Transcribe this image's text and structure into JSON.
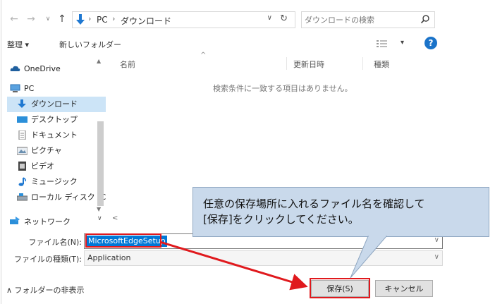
{
  "address_bar": {
    "back_icon": "arrow-left-icon",
    "forward_icon": "arrow-right-icon",
    "up_icon": "arrow-up-icon",
    "path": [
      "PC",
      "ダウンロード"
    ],
    "refresh_icon": "refresh-icon",
    "search_placeholder": "ダウンロードの検索"
  },
  "toolbar": {
    "organize_label": "整理 ▾",
    "new_folder_label": "新しいフォルダー",
    "view_icon": "view-options-icon",
    "help_label": "?"
  },
  "nav_pane": {
    "items": [
      {
        "label": "OneDrive",
        "icon": "cloud-icon"
      },
      {
        "label": "PC",
        "icon": "computer-icon"
      },
      {
        "label": "ダウンロード",
        "icon": "download-arrow-icon"
      },
      {
        "label": "デスクトップ",
        "icon": "desktop-icon"
      },
      {
        "label": "ドキュメント",
        "icon": "document-icon"
      },
      {
        "label": "ピクチャ",
        "icon": "pictures-icon"
      },
      {
        "label": "ビデオ",
        "icon": "video-icon"
      },
      {
        "label": "ミュージック",
        "icon": "music-icon"
      },
      {
        "label": "ローカル ディスク (C",
        "icon": "disk-icon"
      },
      {
        "label": "ネットワーク",
        "icon": "network-icon"
      }
    ],
    "selected_index": 2
  },
  "file_list": {
    "columns": [
      "名前",
      "更新日時",
      "種類"
    ],
    "empty_message": "検索条件に一致する項目はありません。"
  },
  "form": {
    "filename_label": "ファイル名(N):",
    "filename_value": "MicrosoftEdgeSetup",
    "filetype_label": "ファイルの種類(T):",
    "filetype_value": "Application"
  },
  "footer": {
    "hide_folders_label": "∧ フォルダーの非表示",
    "save_label": "保存(S)",
    "cancel_label": "キャンセル"
  },
  "callout": {
    "line1": "任意の保存場所に入れるファイル名を確認して",
    "line2": "[保存]をクリックしてください。"
  },
  "colors": {
    "selection_blue": "#0078d7",
    "annotation_red": "#e0191d",
    "callout_fill": "#c9d9eb",
    "help_blue": "#1a73c9"
  }
}
